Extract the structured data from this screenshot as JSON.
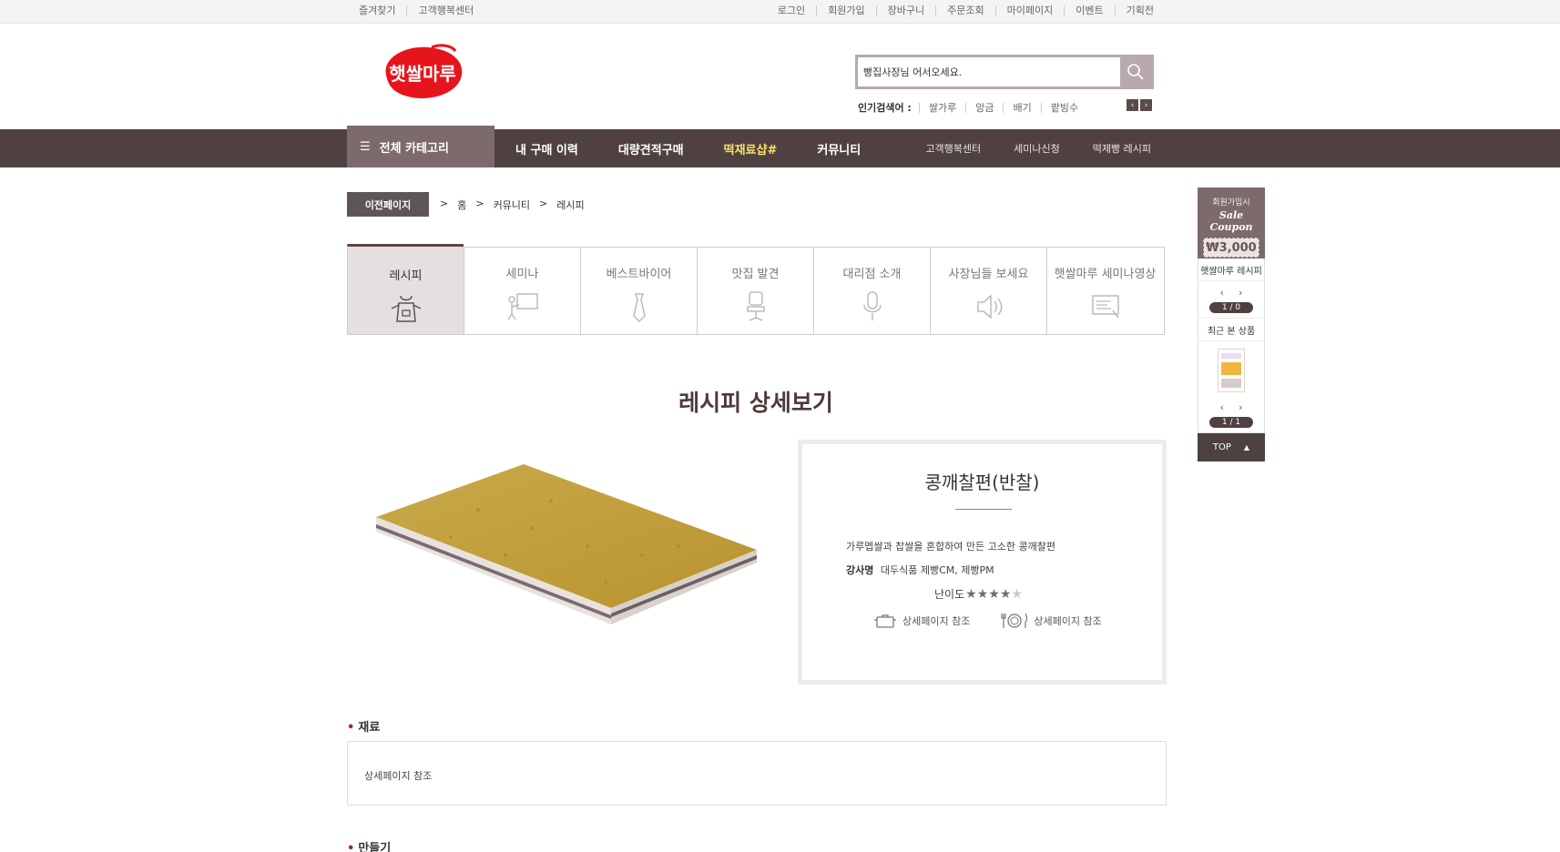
{
  "topbar": {
    "left": [
      "즐겨찾기",
      "고객행복센터"
    ],
    "right": [
      "로그인",
      "회원가입",
      "장바구니",
      "주문조회",
      "마이페이지",
      "이벤트",
      "기획전"
    ]
  },
  "logo": {
    "text": "햇쌀마루",
    "color": "#e8141b"
  },
  "search": {
    "value": "빵집사장님 어서오세요."
  },
  "popular": {
    "label": "인기검색어 :",
    "keywords": [
      "쌀가루",
      "앙금",
      "배기",
      "팥빙수"
    ]
  },
  "nav": {
    "category_label": "전체 카테고리",
    "main": [
      "내 구매 이력",
      "대량견적구매",
      "떡재료샵#",
      "커뮤니티"
    ],
    "highlight_index": 2,
    "sub": [
      "고객행복센터",
      "세미나신청",
      "떡제빵 레시피"
    ]
  },
  "breadcrumb": {
    "prev_label": "이전페이지",
    "items": [
      "홈",
      "커뮤니티",
      "레시피"
    ]
  },
  "tabs": [
    {
      "label": "레시피",
      "icon": "apron-icon"
    },
    {
      "label": "세미나",
      "icon": "presentation-icon"
    },
    {
      "label": "베스트바이어",
      "icon": "necktie-icon"
    },
    {
      "label": "맛집 발견",
      "icon": "chair-icon"
    },
    {
      "label": "대리점 소개",
      "icon": "microphone-icon"
    },
    {
      "label": "사장님들 보세요",
      "icon": "speaker-icon"
    },
    {
      "label": "햇쌀마루 세미나영상",
      "icon": "video-screen-icon"
    }
  ],
  "page_title": "레시피 상세보기",
  "recipe": {
    "name": "콩깨찰편(반찰)",
    "description": "가루멥쌀과 찹쌀을 혼합하여 만든 고소한 콩깨찰편",
    "teacher_label": "강사명",
    "teacher_value": "대두식품 제빵CM, 제빵PM",
    "difficulty_label": "난이도",
    "difficulty": 4,
    "difficulty_max": 5,
    "time_text": "상세페이지 참조",
    "serving_text": "상세페이지 참조"
  },
  "sections": {
    "ingredients_label": "재료",
    "ingredients_text": "상세페이지 참조",
    "method_label": "만들기"
  },
  "side": {
    "coupon_top": "회원가입시",
    "coupon_title": "Sale Coupon",
    "coupon_amount": "₩3,000",
    "recipe_title": "햇쌀마루 레시피",
    "recipe_page": "1 / 0",
    "recent_title": "최근 본 상품",
    "recent_page": "1 / 1",
    "top_label": "TOP"
  }
}
